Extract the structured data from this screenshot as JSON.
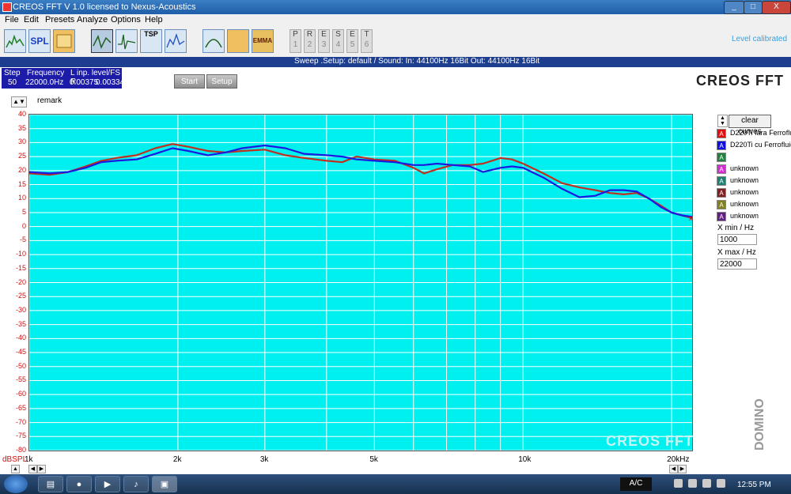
{
  "window": {
    "title": "CREOS FFT V 1.0   licensed to Nexus-Acoustics",
    "min": "_",
    "max": "□",
    "close": "X"
  },
  "menu": [
    "File",
    "Edit",
    "Presets",
    "Analyze",
    "Options",
    "Help"
  ],
  "toolbar": {
    "buttons": [
      "fft-icon",
      "spl-button",
      "folder-icon",
      "freq-response-icon",
      "impulse-icon",
      "tsp-button",
      "spectrum-icon",
      "distortion-icon",
      "waterfall-icon",
      "emma-button"
    ],
    "spl_label": "SPL",
    "tsp_label": "TSP",
    "emma_label": "EMMA",
    "presets": [
      {
        "letter": "P",
        "num": "1"
      },
      {
        "letter": "R",
        "num": "2"
      },
      {
        "letter": "E",
        "num": "3"
      },
      {
        "letter": "S",
        "num": "4"
      },
      {
        "letter": "E",
        "num": "5"
      },
      {
        "letter": "T",
        "num": "6"
      }
    ],
    "level_status": "Level calibrated"
  },
  "infobar": {
    "text": "Sweep .Setup:  default / Sound: In: 44100Hz 16Bit  Out: 44100Hz 16Bit"
  },
  "step_box": {
    "h_step": "Step",
    "h_freq": "Frequency",
    "h_level": "L  inp. level/FS  R",
    "step": "50",
    "frequency": "22000.0Hz",
    "level_l": "0.00375",
    "level_r": "0.00334"
  },
  "controls": {
    "start": "Start",
    "setup": "Setup"
  },
  "logo": "CREOS FFT",
  "remark": "remark",
  "y_axis_label": "dBSPL",
  "right_panel": {
    "clear_curves": "clear curves",
    "legend": [
      {
        "letter": "A",
        "label": "D220Ti fara Ferrofluid",
        "color": "#e01010"
      },
      {
        "letter": "A",
        "label": "D220Ti cu Ferrofluid",
        "color": "#1010e0"
      },
      {
        "letter": "A",
        "label": "",
        "color": "#208040"
      },
      {
        "letter": "A",
        "label": "unknown",
        "color": "#d030d0"
      },
      {
        "letter": "A",
        "label": "unknown",
        "color": "#208070"
      },
      {
        "letter": "A",
        "label": "unknown",
        "color": "#802020"
      },
      {
        "letter": "A",
        "label": "unknown",
        "color": "#808020"
      },
      {
        "letter": "A",
        "label": "unknown",
        "color": "#602080"
      }
    ],
    "xmin_label": "X min / Hz",
    "xmin_value": "1000",
    "xmax_label": "X max / Hz",
    "xmax_value": "22000",
    "vendor": "DOMINO"
  },
  "chart_data": {
    "type": "line",
    "xscale": "log",
    "xlim": [
      1000,
      22000
    ],
    "ylim": [
      -80,
      40
    ],
    "ylabel": "dBSPL",
    "yticks": [
      40,
      35,
      30,
      25,
      20,
      15,
      10,
      5,
      0,
      -5,
      -10,
      -15,
      -20,
      -25,
      -30,
      -35,
      -40,
      -45,
      -50,
      -55,
      -60,
      -65,
      -70,
      -75,
      -80
    ],
    "xticks": [
      {
        "value": 1000,
        "label": "1k"
      },
      {
        "value": 2000,
        "label": "2k"
      },
      {
        "value": 3000,
        "label": "3k"
      },
      {
        "value": 5000,
        "label": "5k"
      },
      {
        "value": 10000,
        "label": "10k"
      },
      {
        "value": 20000,
        "label": "20kHz"
      }
    ],
    "grid": true,
    "watermark": "CREOS FFT",
    "series": [
      {
        "name": "D220Ti fara Ferrofluid",
        "color": "#c03020",
        "points": [
          [
            1000,
            19
          ],
          [
            1100,
            18.5
          ],
          [
            1200,
            19.5
          ],
          [
            1300,
            21.5
          ],
          [
            1400,
            23.5
          ],
          [
            1500,
            24.5
          ],
          [
            1650,
            25.5
          ],
          [
            1800,
            28
          ],
          [
            1950,
            29.5
          ],
          [
            2100,
            28.5
          ],
          [
            2300,
            27
          ],
          [
            2500,
            26.5
          ],
          [
            2700,
            27
          ],
          [
            3000,
            27.5
          ],
          [
            3300,
            25.5
          ],
          [
            3600,
            24.5
          ],
          [
            4000,
            23.5
          ],
          [
            4300,
            23
          ],
          [
            4600,
            25
          ],
          [
            5000,
            24
          ],
          [
            5500,
            23.5
          ],
          [
            6000,
            21
          ],
          [
            6300,
            19
          ],
          [
            6700,
            20.5
          ],
          [
            7200,
            22
          ],
          [
            7800,
            22
          ],
          [
            8300,
            22.5
          ],
          [
            9000,
            24.5
          ],
          [
            9500,
            24
          ],
          [
            10000,
            22.5
          ],
          [
            11000,
            19
          ],
          [
            12000,
            15.5
          ],
          [
            13000,
            14
          ],
          [
            14000,
            13
          ],
          [
            15000,
            12
          ],
          [
            16000,
            11.5
          ],
          [
            17000,
            12
          ],
          [
            18000,
            10
          ],
          [
            19000,
            7.5
          ],
          [
            20000,
            5
          ],
          [
            21000,
            4
          ],
          [
            22000,
            3
          ]
        ]
      },
      {
        "name": "D220Ti cu Ferrofluid",
        "color": "#1a1ae0",
        "points": [
          [
            1000,
            19.5
          ],
          [
            1100,
            19
          ],
          [
            1200,
            19.5
          ],
          [
            1300,
            21
          ],
          [
            1400,
            23
          ],
          [
            1500,
            23.5
          ],
          [
            1650,
            24
          ],
          [
            1800,
            26
          ],
          [
            1950,
            28
          ],
          [
            2100,
            27
          ],
          [
            2300,
            25.5
          ],
          [
            2500,
            26.5
          ],
          [
            2700,
            28
          ],
          [
            3000,
            29
          ],
          [
            3300,
            28
          ],
          [
            3600,
            26
          ],
          [
            4000,
            25.5
          ],
          [
            4300,
            25
          ],
          [
            4600,
            24
          ],
          [
            5000,
            23.5
          ],
          [
            5500,
            23
          ],
          [
            6000,
            22
          ],
          [
            6300,
            22
          ],
          [
            6700,
            22.5
          ],
          [
            7200,
            22
          ],
          [
            7800,
            21.5
          ],
          [
            8300,
            19.5
          ],
          [
            9000,
            21
          ],
          [
            9500,
            21.5
          ],
          [
            10000,
            21
          ],
          [
            11000,
            17.5
          ],
          [
            12000,
            13.5
          ],
          [
            13000,
            10.5
          ],
          [
            14000,
            11
          ],
          [
            15000,
            13
          ],
          [
            16000,
            13
          ],
          [
            17000,
            12.5
          ],
          [
            18000,
            10
          ],
          [
            19000,
            7
          ],
          [
            20000,
            5
          ],
          [
            21000,
            4
          ],
          [
            22000,
            3.5
          ]
        ]
      }
    ]
  },
  "taskbar": {
    "lang": "A/C",
    "clock": "12:55 PM"
  }
}
